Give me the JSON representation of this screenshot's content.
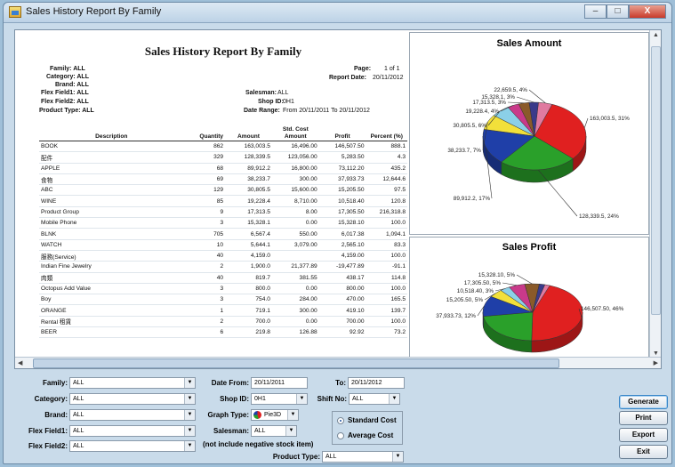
{
  "window": {
    "title": "Sales History Report By Family",
    "min": "–",
    "max": "□",
    "close": "X"
  },
  "report": {
    "title": "Sales History Report By Family",
    "family": "Family: ALL",
    "category": "Category: ALL",
    "brand": "Brand: ALL",
    "flex1": "Flex Field1: ALL",
    "flex2": "Flex Field2: ALL",
    "product_type": "Product Type: ALL",
    "salesman_label": "Salesman:",
    "salesman": "ALL",
    "shop_label": "Shop ID:",
    "shop": "0H1",
    "date_range_label": "Date Range:",
    "date_range": "From 20/11/2011 To 20/11/2012",
    "page_label": "Page:",
    "page": "1 of 1",
    "report_date_label": "Report Date:",
    "report_date": "20/11/2012",
    "columns": [
      "Description",
      "Quantity",
      "Amount",
      "Std. Cost Amount",
      "Profit",
      "Percent (%)"
    ],
    "rows": [
      [
        "BOOK",
        "862",
        "163,003.5",
        "16,496.00",
        "146,507.50",
        "888.1"
      ],
      [
        "配件",
        "329",
        "128,339.5",
        "123,056.00",
        "5,283.50",
        "4.3"
      ],
      [
        "APPLE",
        "68",
        "89,912.2",
        "16,800.00",
        "73,112.20",
        "435.2"
      ],
      [
        "食物",
        "69",
        "38,233.7",
        "300.00",
        "37,933.73",
        "12,644.6"
      ],
      [
        "ABC",
        "129",
        "30,805.5",
        "15,600.00",
        "15,205.50",
        "97.5"
      ],
      [
        "WINE",
        "85",
        "19,228.4",
        "8,710.00",
        "10,518.40",
        "120.8"
      ],
      [
        "Product Group",
        "9",
        "17,313.5",
        "8.00",
        "17,305.50",
        "216,318.8"
      ],
      [
        "Mobile Phone",
        "3",
        "15,328.1",
        "0.00",
        "15,328.10",
        "100.0"
      ],
      [
        "BLNK",
        "705",
        "6,567.4",
        "550.00",
        "6,017.38",
        "1,094.1"
      ],
      [
        "WATCH",
        "10",
        "5,644.1",
        "3,079.00",
        "2,565.10",
        "83.3"
      ],
      [
        "服務(Service)",
        "40",
        "4,159.0",
        "",
        "4,159.00",
        "100.0"
      ],
      [
        "Indian Fine Jewelry",
        "2",
        "1,900.0",
        "21,377.89",
        "-19,477.89",
        "-91.1"
      ],
      [
        "肉類",
        "40",
        "819.7",
        "381.55",
        "438.17",
        "114.8"
      ],
      [
        "Octopus Add Value",
        "3",
        "800.0",
        "0.00",
        "800.00",
        "100.0"
      ],
      [
        "Boy",
        "3",
        "754.0",
        "284.00",
        "470.00",
        "165.5"
      ],
      [
        "ORANGE",
        "1",
        "719.1",
        "300.00",
        "419.10",
        "139.7"
      ],
      [
        "Rental 租賃",
        "2",
        "700.0",
        "0.00",
        "700.00",
        "100.0"
      ],
      [
        "BEER",
        "6",
        "219.8",
        "126.88",
        "92.92",
        "73.2"
      ]
    ]
  },
  "chart_data": [
    {
      "type": "pie",
      "title": "Sales Amount",
      "labels": [
        "163,003.5, 31%",
        "128,339.5, 24%",
        "89,912.2, 17%",
        "38,233.7, 7%",
        "30,805.5, 6%",
        "19,228.4, 4%",
        "17,313.5, 3%",
        "15,328.1, 3%",
        "22,659.5, 4%"
      ],
      "values": [
        163003.5,
        128339.5,
        89912.2,
        38233.7,
        30805.5,
        19228.4,
        17313.5,
        15328.1,
        22659.5
      ],
      "colors": [
        "#e02020",
        "#2aa02a",
        "#1f3fa8",
        "#f2e03a",
        "#8bd0e8",
        "#c93a8a",
        "#8a5a2a",
        "#3a3a8a",
        "#e07aa0"
      ]
    },
    {
      "type": "pie",
      "title": "Sales Profit",
      "labels": [
        "146,507.50, 46%",
        "",
        "37,933.73, 12%",
        "15,205.50, 5%",
        "10,518.40, 3%",
        "17,305.50, 5%",
        "15,328.10, 5%",
        "",
        ""
      ],
      "values": [
        146507.5,
        73112.2,
        37933.73,
        15205.5,
        10518.4,
        17305.5,
        15328.1,
        6017.38,
        5283.5
      ],
      "colors": [
        "#e02020",
        "#2aa02a",
        "#1f3fa8",
        "#f2e03a",
        "#8bd0e8",
        "#c93a8a",
        "#8a5a2a",
        "#3a3a8a",
        "#e07aa0"
      ]
    }
  ],
  "form": {
    "family_label": "Family:",
    "family": "ALL",
    "category_label": "Category:",
    "category": "ALL",
    "brand_label": "Brand:",
    "brand": "ALL",
    "flex1_label": "Flex Field1:",
    "flex1": "ALL",
    "flex2_label": "Flex Field2:",
    "flex2": "ALL",
    "date_from_label": "Date From:",
    "date_from": "20/11/2011",
    "to_label": "To:",
    "date_to": "20/11/2012",
    "shop_label": "Shop ID:",
    "shop": "0H1",
    "shift_label": "Shift No:",
    "shift": "ALL",
    "graph_label": "Graph Type:",
    "graph": "Pie3D",
    "salesman_label": "Salesman:",
    "salesman": "ALL",
    "note": "(not include negative stock item)",
    "product_type_label": "Product Type:",
    "product_type": "ALL",
    "standard_cost": "Standard Cost",
    "average_cost": "Average Cost",
    "generate": "Generate",
    "print": "Print",
    "export": "Export",
    "exit": "Exit"
  }
}
